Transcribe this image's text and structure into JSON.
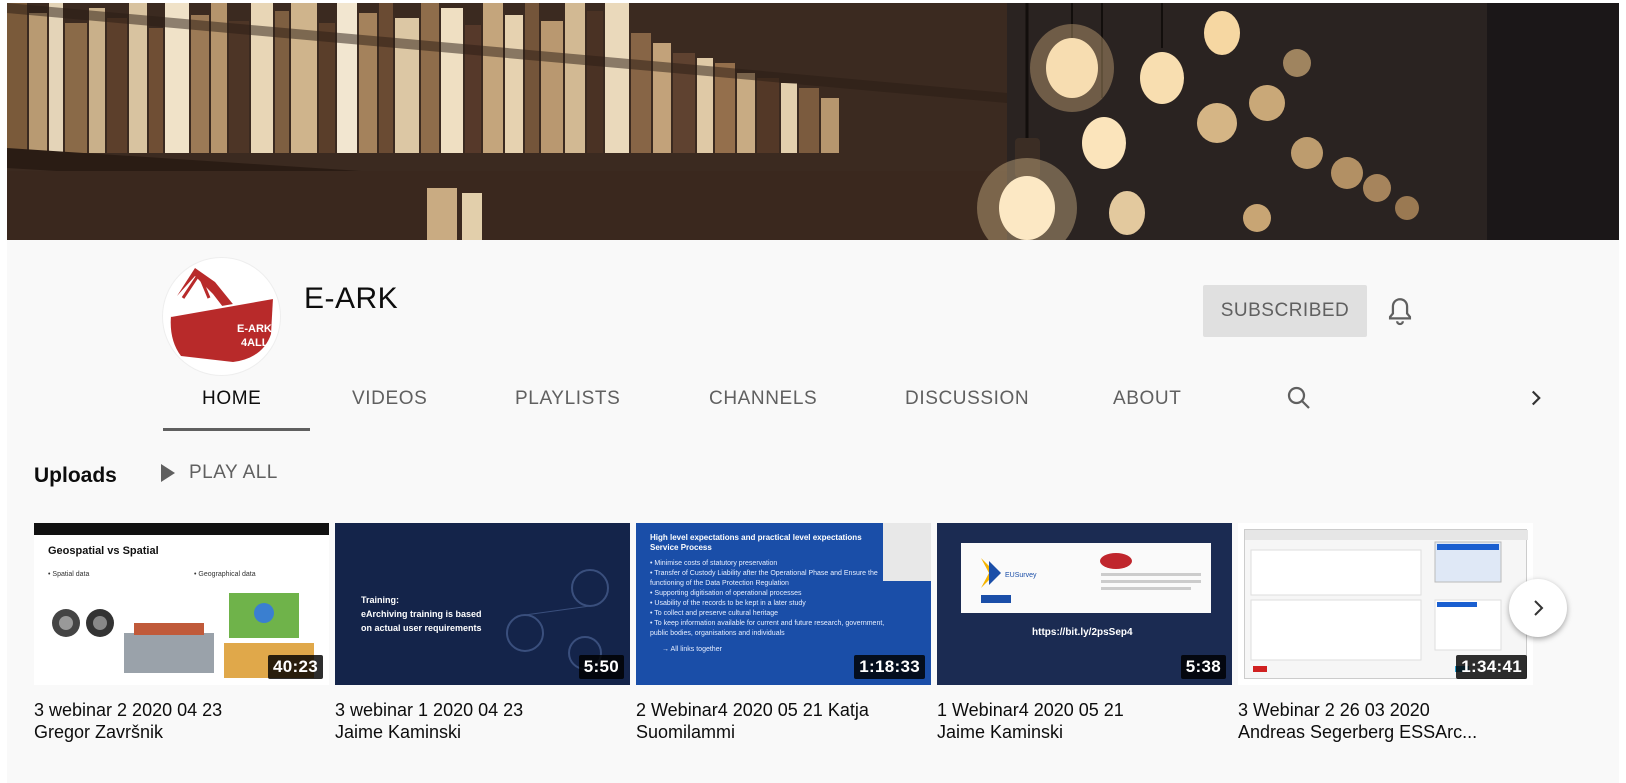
{
  "channel": {
    "name": "E-ARK",
    "avatar_text_line1": "E-ARK",
    "avatar_text_line2": "4ALL",
    "subscribe_label": "SUBSCRIBED"
  },
  "tabs": [
    {
      "label": "HOME",
      "active": true
    },
    {
      "label": "VIDEOS"
    },
    {
      "label": "PLAYLISTS"
    },
    {
      "label": "CHANNELS"
    },
    {
      "label": "DISCUSSION"
    },
    {
      "label": "ABOUT"
    }
  ],
  "icons": {
    "bell": "bell-icon",
    "search": "search-icon",
    "tab_next": "chevron-right-icon",
    "shelf_next": "chevron-right-icon",
    "play": "play-icon"
  },
  "uploads": {
    "title": "Uploads",
    "play_all_label": "PLAY ALL"
  },
  "videos": [
    {
      "title_line1": "3 webinar 2 2020 04 23",
      "title_line2": "Gregor Završnik",
      "duration": "40:23",
      "thumb": {
        "heading": "Geospatial vs Spatial",
        "col1": "• Spatial data",
        "col2": "• Geographical data"
      }
    },
    {
      "title_line1": "3 webinar 1 2020 04 23",
      "title_line2": "Jaime Kaminski",
      "duration": "5:50",
      "thumb": {
        "line1": "Training:",
        "line2": "eArchiving training is based",
        "line3": "on actual user requirements"
      }
    },
    {
      "title_line1": "2 Webinar4 2020 05 21 Katja",
      "title_line2": "Suomilammi",
      "duration": "1:18:33",
      "thumb": {
        "heading": "High level expectations and practical level expectations Service Process",
        "b1": "• Minimise costs of statutory preservation",
        "b2": "• Transfer of Custody Liability after the Operational Phase and Ensure the functioning of the Data Protection Regulation",
        "b3": "• Supporting digitisation of operational processes",
        "b4": "• Usability of the records to be kept in a later study",
        "b5": "• To collect and preserve cultural heritage",
        "b6": "• To keep information available for current and future research, government, public bodies, organisations and individuals",
        "b7": "→ All links together"
      }
    },
    {
      "title_line1": "1 Webinar4 2020 05 21",
      "title_line2": "Jaime Kaminski",
      "duration": "5:38",
      "thumb": {
        "brand": "EUSurvey",
        "url": "https://bit.ly/2psSep4"
      }
    },
    {
      "title_line1": "3 Webinar 2 26 03 2020",
      "title_line2": "Andreas Segerberg ESSArc...",
      "duration": "1:34:41",
      "thumb": {}
    }
  ],
  "colors": {
    "header_bg": "#f9f9f9",
    "brand_red": "#b82a2a",
    "text_primary": "#0d0d0d",
    "text_secondary": "#606060",
    "subscribed_bg": "#e0e0e0"
  }
}
